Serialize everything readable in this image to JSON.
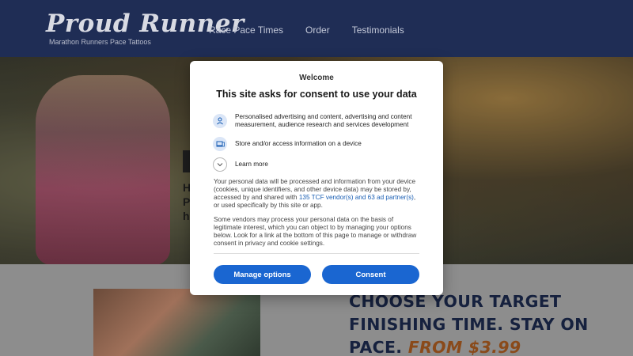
{
  "header": {
    "logo_title": "Proud Runner",
    "logo_tagline": "Marathon Runners Pace Tattoos",
    "nav": [
      "Race Pace Times",
      "Order",
      "Testimonials"
    ]
  },
  "hero": {
    "letters": [
      "H",
      "P",
      "h"
    ]
  },
  "lower": {
    "cta_line1": "CHOOSE YOUR TARGET",
    "cta_line2": "FINISHING TIME. STAY ON",
    "cta_line3": "PACE.",
    "cta_price": "FROM $3.99"
  },
  "consent": {
    "welcome": "Welcome",
    "heading": "This site asks for consent to use your data",
    "purposes": [
      {
        "icon": "person-icon",
        "text": "Personalised advertising and content, advertising and content measurement, audience research and services development"
      },
      {
        "icon": "device-icon",
        "text": "Store and/or access information on a device"
      },
      {
        "icon": "chevron-down-icon",
        "text": "Learn more"
      }
    ],
    "para1_before": "Your personal data will be processed and information from your device (cookies, unique identifiers, and other device data) may be stored by, accessed by and shared with ",
    "para1_link": "135 TCF vendor(s) and 63 ad partner(s)",
    "para1_after": ", or used specifically by this site or app.",
    "para2": "Some vendors may process your personal data on the basis of legitimate interest, which you can object to by managing your options below. Look for a link at the bottom of this page to manage or withdraw consent in privacy and cookie settings.",
    "manage_label": "Manage options",
    "consent_label": "Consent"
  },
  "colors": {
    "header_bg": "#1f2d55",
    "button_blue": "#1a66d1",
    "link_blue": "#1a5fb4"
  }
}
